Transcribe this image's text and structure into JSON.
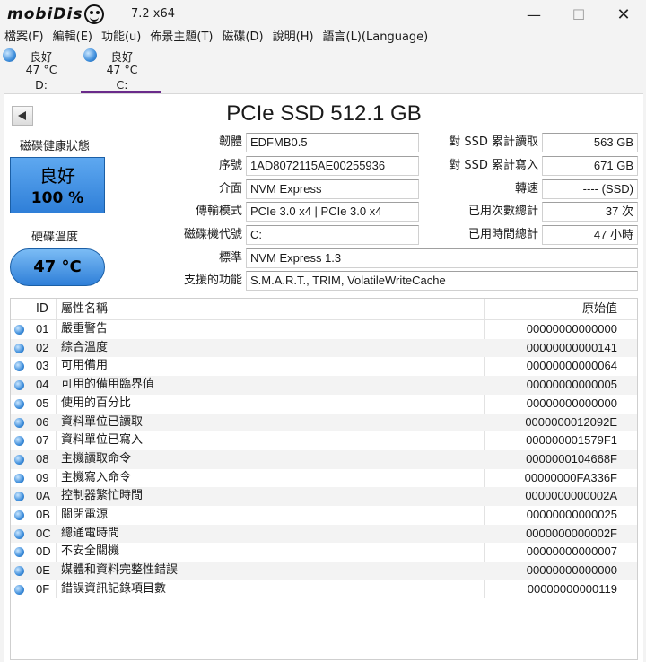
{
  "window": {
    "logo_text": "mobiDis",
    "title": "7.2 x64",
    "minimize_icon": "minimize-icon",
    "maximize_icon": "maximize-icon",
    "close_icon": "close-icon"
  },
  "menu": [
    {
      "label": "檔案(F)"
    },
    {
      "label": "編輯(E)"
    },
    {
      "label": "功能(u)"
    },
    {
      "label": "佈景主題(T)"
    },
    {
      "label": "磁碟(D)"
    },
    {
      "label": "說明(H)"
    },
    {
      "label": "語言(L)(Language)"
    }
  ],
  "drives": [
    {
      "status": "良好",
      "temp": "47 °C",
      "letter": "D:"
    },
    {
      "status": "良好",
      "temp": "47 °C",
      "letter": "C:"
    }
  ],
  "model": "PCIe SSD 512.1 GB",
  "health": {
    "label": "磁碟健康狀態",
    "status": "良好",
    "percent": "100 %"
  },
  "temperature": {
    "label": "硬碟溫度",
    "value": "47 °C"
  },
  "info": {
    "firmware": {
      "label": "韌體",
      "value": "EDFMB0.5"
    },
    "serial": {
      "label": "序號",
      "value": "1AD8072115AE00255936"
    },
    "interface": {
      "label": "介面",
      "value": "NVM Express"
    },
    "transfer": {
      "label": "傳輸模式",
      "value": "PCIe 3.0 x4 | PCIe 3.0 x4"
    },
    "drive_letter": {
      "label": "磁碟機代號",
      "value": "C:"
    },
    "standard": {
      "label": "標準",
      "value": "NVM Express 1.3"
    },
    "features": {
      "label": "支援的功能",
      "value": "S.M.A.R.T., TRIM, VolatileWriteCache"
    },
    "total_reads": {
      "label": "對 SSD 累計讀取",
      "value": "563 GB"
    },
    "total_writes": {
      "label": "對 SSD 累計寫入",
      "value": "671 GB"
    },
    "rotation": {
      "label": "轉速",
      "value": "---- (SSD)"
    },
    "power_on_count": {
      "label": "已用次數總計",
      "value": "37 次"
    },
    "power_on_hours": {
      "label": "已用時間總計",
      "value": "47 小時"
    }
  },
  "table": {
    "headers": {
      "id": "ID",
      "name": "屬性名稱",
      "raw": "原始值"
    },
    "rows": [
      {
        "id": "01",
        "name": "嚴重警告",
        "raw": "00000000000000"
      },
      {
        "id": "02",
        "name": "綜合溫度",
        "raw": "00000000000141"
      },
      {
        "id": "03",
        "name": "可用備用",
        "raw": "00000000000064"
      },
      {
        "id": "04",
        "name": "可用的備用臨界值",
        "raw": "00000000000005"
      },
      {
        "id": "05",
        "name": "使用的百分比",
        "raw": "00000000000000"
      },
      {
        "id": "06",
        "name": "資料單位已讀取",
        "raw": "0000000012092E"
      },
      {
        "id": "07",
        "name": "資料單位已寫入",
        "raw": "000000001579F1"
      },
      {
        "id": "08",
        "name": "主機讀取命令",
        "raw": "0000000104668F"
      },
      {
        "id": "09",
        "name": "主機寫入命令",
        "raw": "00000000FA336F"
      },
      {
        "id": "0A",
        "name": "控制器繁忙時間",
        "raw": "0000000000002A"
      },
      {
        "id": "0B",
        "name": "關閉電源",
        "raw": "00000000000025"
      },
      {
        "id": "0C",
        "name": "總通電時間",
        "raw": "0000000000002F"
      },
      {
        "id": "0D",
        "name": "不安全關機",
        "raw": "00000000000007"
      },
      {
        "id": "0E",
        "name": "媒體和資料完整性錯誤",
        "raw": "00000000000000"
      },
      {
        "id": "0F",
        "name": "錯誤資訊記錄項目數",
        "raw": "00000000000119"
      }
    ]
  }
}
